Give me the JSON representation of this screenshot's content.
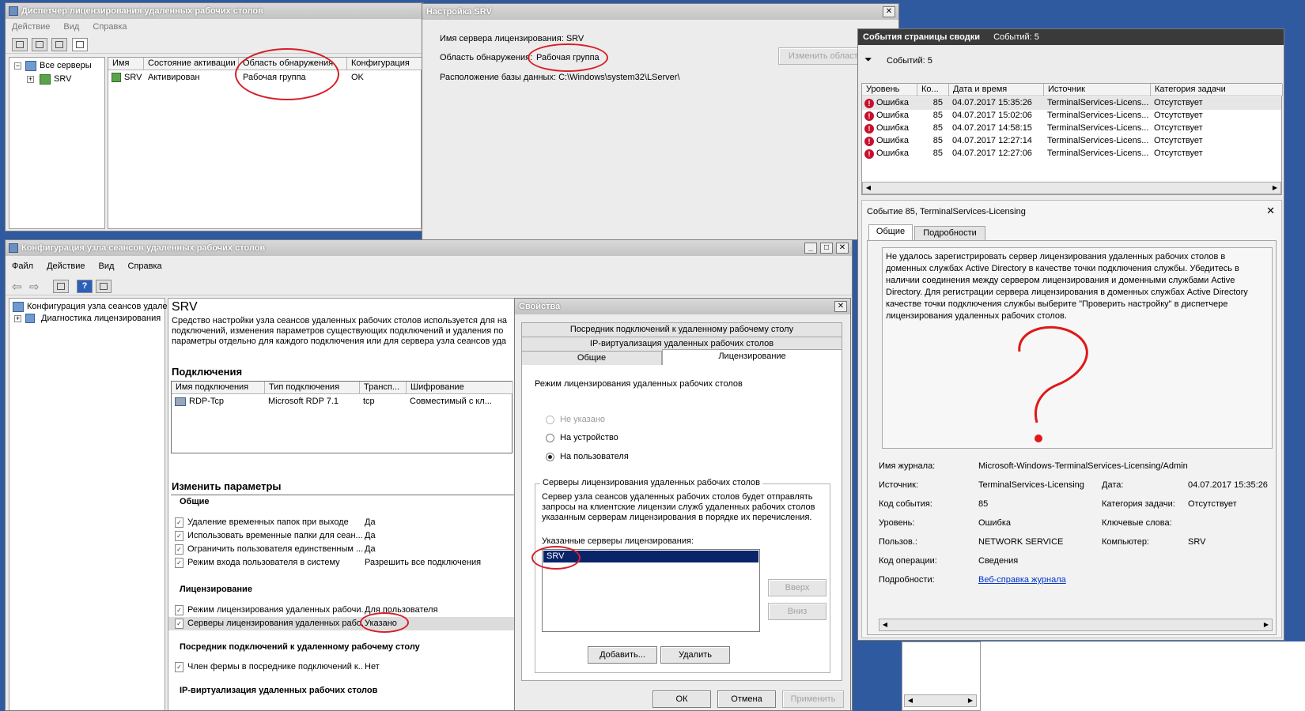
{
  "licensing_manager": {
    "title": "Диспетчер лицензирования удаленных рабочих столов",
    "menu": [
      "Действие",
      "Вид",
      "Справка"
    ],
    "tree_root": "Все серверы",
    "tree_child": "SRV",
    "columns": [
      "Имя",
      "Состояние активации",
      "Область обнаружения",
      "Конфигурация"
    ],
    "row": {
      "name": "SRV",
      "state": "Активирован",
      "scope": "Рабочая группа",
      "config": "OK"
    }
  },
  "srv_settings": {
    "title": "Настройка SRV",
    "server_line": "Имя сервера лицензирования: SRV",
    "scope_label": "Область обнаружения:",
    "scope_value": "Рабочая группа",
    "change_button": "Изменить область",
    "db_line": "Расположение базы данных: C:\\Windows\\system32\\LServer\\"
  },
  "events": {
    "title": "События страницы сводки",
    "count_title": "Событий: 5",
    "filter_text": "Событий: 5",
    "columns": [
      "Уровень",
      "Ко...",
      "Дата и время",
      "Источник",
      "Категория задачи"
    ],
    "rows": [
      {
        "level": "Ошибка",
        "code": "85",
        "date": "04.07.2017 15:35:26",
        "source": "TerminalServices-Licens...",
        "category": "Отсутствует"
      },
      {
        "level": "Ошибка",
        "code": "85",
        "date": "04.07.2017 15:02:06",
        "source": "TerminalServices-Licens...",
        "category": "Отсутствует"
      },
      {
        "level": "Ошибка",
        "code": "85",
        "date": "04.07.2017 14:58:15",
        "source": "TerminalServices-Licens...",
        "category": "Отсутствует"
      },
      {
        "level": "Ошибка",
        "code": "85",
        "date": "04.07.2017 12:27:14",
        "source": "TerminalServices-Licens...",
        "category": "Отсутствует"
      },
      {
        "level": "Ошибка",
        "code": "85",
        "date": "04.07.2017 12:27:06",
        "source": "TerminalServices-Licens...",
        "category": "Отсутствует"
      }
    ]
  },
  "event_detail": {
    "title": "Событие 85, TerminalServices-Licensing",
    "tabs": [
      "Общие",
      "Подробности"
    ],
    "message": "Не удалось зарегистрировать сервер лицензирования удаленных рабочих столов в доменных службах Active Directory в качестве точки подключения службы. Убедитесь в наличии соединения между сервером лицензирования и доменными службами Active Directory. Для регистрации сервера лицензирования в доменных службах Active Directory качестве точки подключения службы выберите \"Проверить настройку\" в диспетчере лицензирования удаленных рабочих столов.",
    "fields": {
      "log_name_label": "Имя журнала:",
      "log_name": "Microsoft-Windows-TerminalServices-Licensing/Admin",
      "source_label": "Источник:",
      "source": "TerminalServices-Licensing",
      "date_label": "Дата:",
      "date": "04.07.2017 15:35:26",
      "event_code_label": "Код события:",
      "event_code": "85",
      "task_label": "Категория задачи:",
      "task": "Отсутствует",
      "level_label": "Уровень:",
      "level": "Ошибка",
      "keywords_label": "Ключевые слова:",
      "user_label": "Пользов.:",
      "user": "NETWORK SERVICE",
      "computer_label": "Компьютер:",
      "computer": "SRV",
      "opcode_label": "Код операции:",
      "opcode": "Сведения",
      "details_label": "Подробности:",
      "details_link": "Веб-справка журнала"
    }
  },
  "session_host": {
    "title": "Конфигурация узла сеансов удаленных рабочих столов",
    "menu": [
      "Файл",
      "Действие",
      "Вид",
      "Справка"
    ],
    "tree_root": "Конфигурация узла сеансов удале",
    "tree_child": "Диагностика лицензирования",
    "heading": "SRV",
    "description": [
      "Средство настройки узла сеансов удаленных рабочих столов используется для на",
      "подключений, изменения параметров существующих подключений и удаления по",
      "параметры отдельно для каждого подключения или для сервера узла сеансов уда"
    ],
    "connections_title": "Подключения",
    "conn_columns": [
      "Имя подключения",
      "Тип подключения",
      "Трансп...",
      "Шифрование"
    ],
    "conn_row": {
      "name": "RDP-Tcp",
      "type": "Microsoft RDP 7.1",
      "transport": "tcp",
      "encryption": "Совместимый с кл..."
    },
    "change_title": "Изменить параметры",
    "general_title": "Общие",
    "general_rows": [
      {
        "label": "Удаление временных папок при выходе",
        "value": "Да"
      },
      {
        "label": "Использовать временные папки для сеан...",
        "value": "Да"
      },
      {
        "label": "Ограничить пользователя единственным ...",
        "value": "Да"
      },
      {
        "label": "Режим входа пользователя в систему",
        "value": "Разрешить все подключения"
      }
    ],
    "licensing_title": "Лицензирование",
    "licensing_rows": [
      {
        "label": "Режим лицензирования удаленных рабочи...",
        "value": "Для пользователя"
      },
      {
        "label": "Серверы лицензирования удаленных рабо...",
        "value": "Указано"
      }
    ],
    "broker_title": "Посредник подключений к удаленному рабочему столу",
    "broker_rows": [
      {
        "label": "Член фермы в посреднике подключений к...",
        "value": "Нет"
      }
    ],
    "ipvirt_title": "IP-виртуализация удаленных рабочих столов"
  },
  "properties": {
    "title": "Свойства",
    "tabs_row1": [
      "Посредник подключений к удаленному рабочему столу"
    ],
    "tabs_row2": [
      "IP-виртуализация удаленных рабочих столов"
    ],
    "tabs_row3": [
      "Общие",
      "Лицензирование"
    ],
    "mode_title": "Режим лицензирования удаленных рабочих столов",
    "options": [
      "Не указано",
      "На устройство",
      "На пользователя"
    ],
    "servers_group": "Серверы лицензирования удаленных рабочих столов",
    "servers_desc": [
      "Сервер узла сеансов удаленных рабочих столов будет отправлять",
      "запросы на клиентские лицензии служб удаленных рабочих столов",
      "указанным серверам лицензирования в порядке их перечисления."
    ],
    "list_label": "Указанные серверы лицензирования:",
    "list_items": [
      "SRV"
    ],
    "up": "Вверх",
    "down": "Вниз",
    "add": "Добавить...",
    "remove": "Удалить",
    "ok": "ОК",
    "cancel": "Отмена",
    "apply": "Применить"
  },
  "colors": {
    "accent_red": "#d6202a",
    "selection": "#0a246a",
    "link": "#0033cc",
    "error": "#c8102e"
  }
}
